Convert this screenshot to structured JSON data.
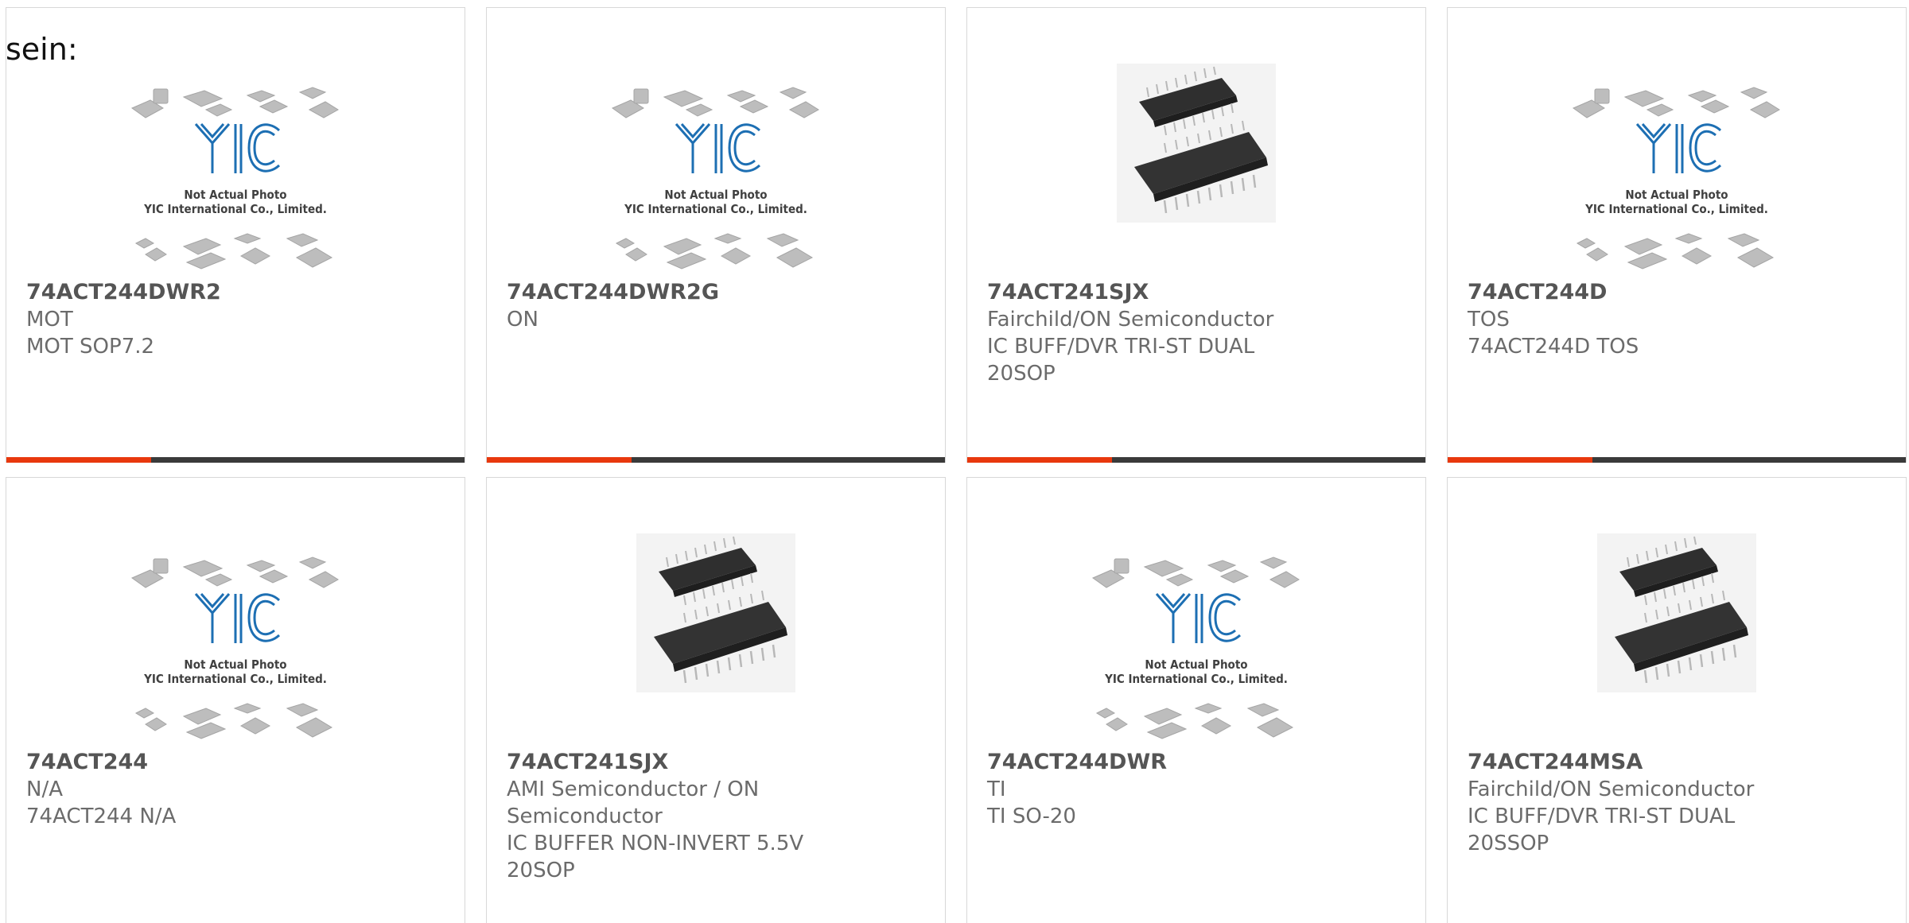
{
  "header": {
    "label": "sein:"
  },
  "brand": {
    "accent_color": "#e8380d",
    "bar_color": "#3a3a3a",
    "logo_color": "#1d6fb3"
  },
  "placeholder": {
    "line1": "Not Actual Photo",
    "line2": "YIC International Co., Limited.",
    "logo_text": "YIC"
  },
  "products": [
    {
      "part": "74ACT244DWR2",
      "maker": "MOT",
      "desc": [
        "MOT SOP7.2"
      ],
      "image": "yic-placeholder"
    },
    {
      "part": "74ACT244DWR2G",
      "maker": "ON",
      "desc": [],
      "image": "yic-placeholder"
    },
    {
      "part": "74ACT241SJX",
      "maker": "Fairchild/ON Semiconductor",
      "desc": [
        "IC BUFF/DVR TRI-ST DUAL",
        "20SOP"
      ],
      "image": "chip-photo"
    },
    {
      "part": "74ACT244D",
      "maker": "TOS",
      "desc": [
        "74ACT244D TOS"
      ],
      "image": "yic-placeholder"
    },
    {
      "part": "74ACT244",
      "maker": "N/A",
      "desc": [
        "74ACT244 N/A"
      ],
      "image": "yic-placeholder"
    },
    {
      "part": "74ACT241SJX",
      "maker": "AMI Semiconductor / ON",
      "desc": [
        "Semiconductor",
        "IC BUFFER NON-INVERT 5.5V",
        "20SOP"
      ],
      "image": "chip-photo"
    },
    {
      "part": "74ACT244DWR",
      "maker": "TI",
      "desc": [
        "TI SO-20"
      ],
      "image": "yic-placeholder"
    },
    {
      "part": "74ACT244MSA",
      "maker": "Fairchild/ON Semiconductor",
      "desc": [
        "IC BUFF/DVR TRI-ST DUAL",
        "20SSOP"
      ],
      "image": "chip-photo"
    }
  ]
}
